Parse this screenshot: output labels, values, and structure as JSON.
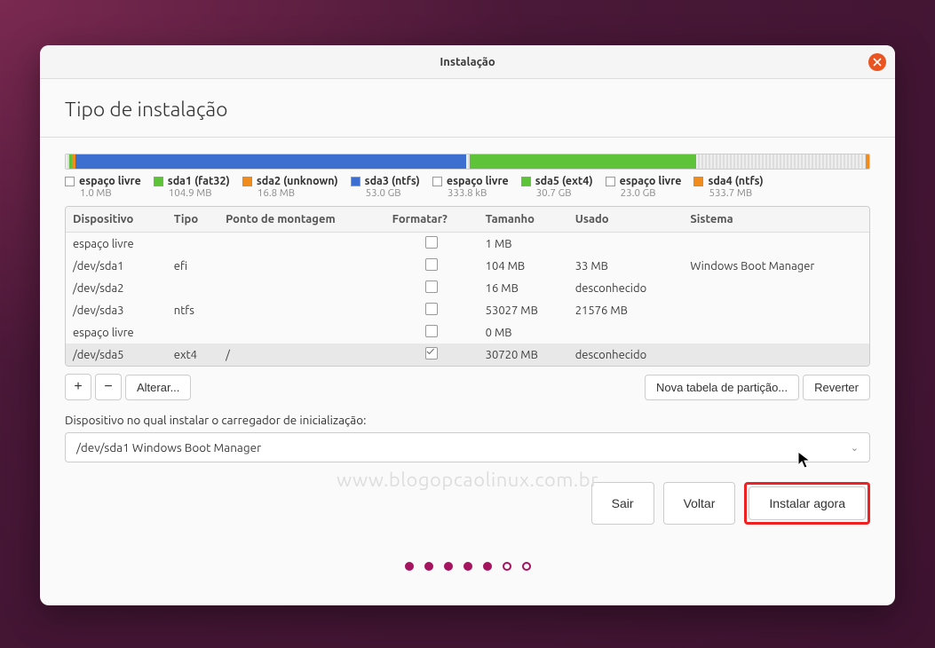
{
  "window": {
    "title": "Instalação"
  },
  "page": {
    "heading": "Tipo de instalação"
  },
  "colors": {
    "free": "#ffffff",
    "fat32": "#5fc339",
    "unknown": "#f08c1e",
    "ntfs": "#3d6fd0",
    "ext4": "#5fc339"
  },
  "legend": [
    {
      "key": "free",
      "label": "espaço livre",
      "size": "1.0 MB"
    },
    {
      "key": "fat32",
      "label": "sda1 (fat32)",
      "size": "104.9 MB"
    },
    {
      "key": "unknown",
      "label": "sda2 (unknown)",
      "size": "16.8 MB"
    },
    {
      "key": "ntfs",
      "label": "sda3 (ntfs)",
      "size": "53.0 GB"
    },
    {
      "key": "free",
      "label": "espaço livre",
      "size": "333.8 kB"
    },
    {
      "key": "ext4",
      "label": "sda5 (ext4)",
      "size": "30.7 GB"
    },
    {
      "key": "free",
      "label": "espaço livre",
      "size": "23.0 GB"
    },
    {
      "key": "unknown",
      "label": "sda4 (ntfs)",
      "size": "533.7 MB"
    }
  ],
  "table": {
    "headers": {
      "device": "Dispositivo",
      "type": "Tipo",
      "mount": "Ponto de montagem",
      "format": "Formatar?",
      "size": "Tamanho",
      "used": "Usado",
      "system": "Sistema"
    },
    "rows": [
      {
        "device": "espaço livre",
        "type": "",
        "mount": "",
        "format": false,
        "size": "1 MB",
        "used": "",
        "system": ""
      },
      {
        "device": "/dev/sda1",
        "type": "efi",
        "mount": "",
        "format": false,
        "size": "104 MB",
        "used": "33 MB",
        "system": "Windows Boot Manager"
      },
      {
        "device": "/dev/sda2",
        "type": "",
        "mount": "",
        "format": false,
        "size": "16 MB",
        "used": "desconhecido",
        "system": ""
      },
      {
        "device": "/dev/sda3",
        "type": "ntfs",
        "mount": "",
        "format": false,
        "size": "53027 MB",
        "used": "21576 MB",
        "system": ""
      },
      {
        "device": "espaço livre",
        "type": "",
        "mount": "",
        "format": false,
        "size": "0 MB",
        "used": "",
        "system": ""
      },
      {
        "device": "/dev/sda5",
        "type": "ext4",
        "mount": "/",
        "format": true,
        "size": "30720 MB",
        "used": "desconhecido",
        "system": "",
        "selected": true
      }
    ]
  },
  "toolbar": {
    "add": "+",
    "remove": "−",
    "change": "Alterar...",
    "new_table": "Nova tabela de partição...",
    "revert": "Reverter"
  },
  "bootloader": {
    "label": "Dispositivo no qual instalar o carregador de inicialização:",
    "value": "/dev/sda1 Windows Boot Manager"
  },
  "actions": {
    "quit": "Sair",
    "back": "Voltar",
    "install": "Instalar agora"
  },
  "watermark": "www.blogopcaolinux.com.br",
  "progress": {
    "total": 7,
    "current": 5
  }
}
